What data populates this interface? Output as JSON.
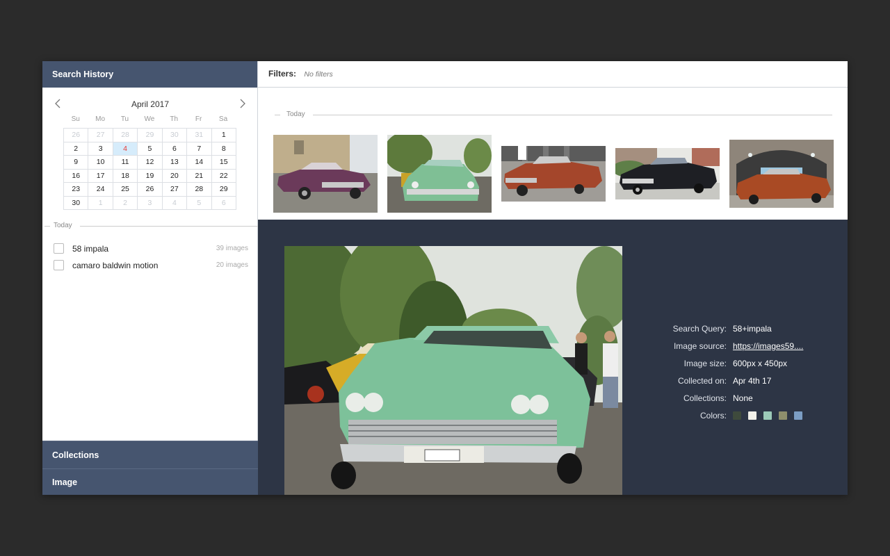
{
  "sidebar": {
    "title": "Search History",
    "calendar": {
      "title": "April 2017",
      "weekdays": [
        "Su",
        "Mo",
        "Tu",
        "We",
        "Th",
        "Fr",
        "Sa"
      ],
      "weeks": [
        [
          "26",
          "27",
          "28",
          "29",
          "30",
          "31",
          "1"
        ],
        [
          "2",
          "3",
          "4",
          "5",
          "6",
          "7",
          "8"
        ],
        [
          "9",
          "10",
          "11",
          "12",
          "13",
          "14",
          "15"
        ],
        [
          "16",
          "17",
          "18",
          "19",
          "20",
          "21",
          "22"
        ],
        [
          "23",
          "24",
          "25",
          "26",
          "27",
          "28",
          "29"
        ],
        [
          "30",
          "1",
          "2",
          "3",
          "4",
          "5",
          "6"
        ]
      ],
      "selected_day": "4"
    },
    "history_label": "Today",
    "history": [
      {
        "query": "58 impala",
        "count": "39 images"
      },
      {
        "query": "camaro baldwin motion",
        "count": "20 images"
      }
    ],
    "collections_title": "Collections",
    "image_title": "Image"
  },
  "filters": {
    "label": "Filters:",
    "value": "No filters"
  },
  "results": {
    "group_label": "Today",
    "selected_index": 1
  },
  "detail": {
    "fields": [
      {
        "key": "Search Query:",
        "value": "58+impala"
      },
      {
        "key": "Image source:",
        "value": "https://images59...."
      },
      {
        "key": "Image size:",
        "value": "600px x 450px"
      },
      {
        "key": "Collected on:",
        "value": "Apr 4th 17"
      },
      {
        "key": "Collections:",
        "value": "None"
      }
    ],
    "colors_label": "Colors:",
    "colors": [
      "#3e4a3c",
      "#f2f1ea",
      "#9ccab8",
      "#8e8f6c",
      "#7c9ec4"
    ]
  },
  "theme": {
    "header_bg": "#46556f",
    "detail_bg": "#2d3545",
    "selected_day_bg": "#d6ecfb",
    "selected_day_text": "#e53935"
  }
}
